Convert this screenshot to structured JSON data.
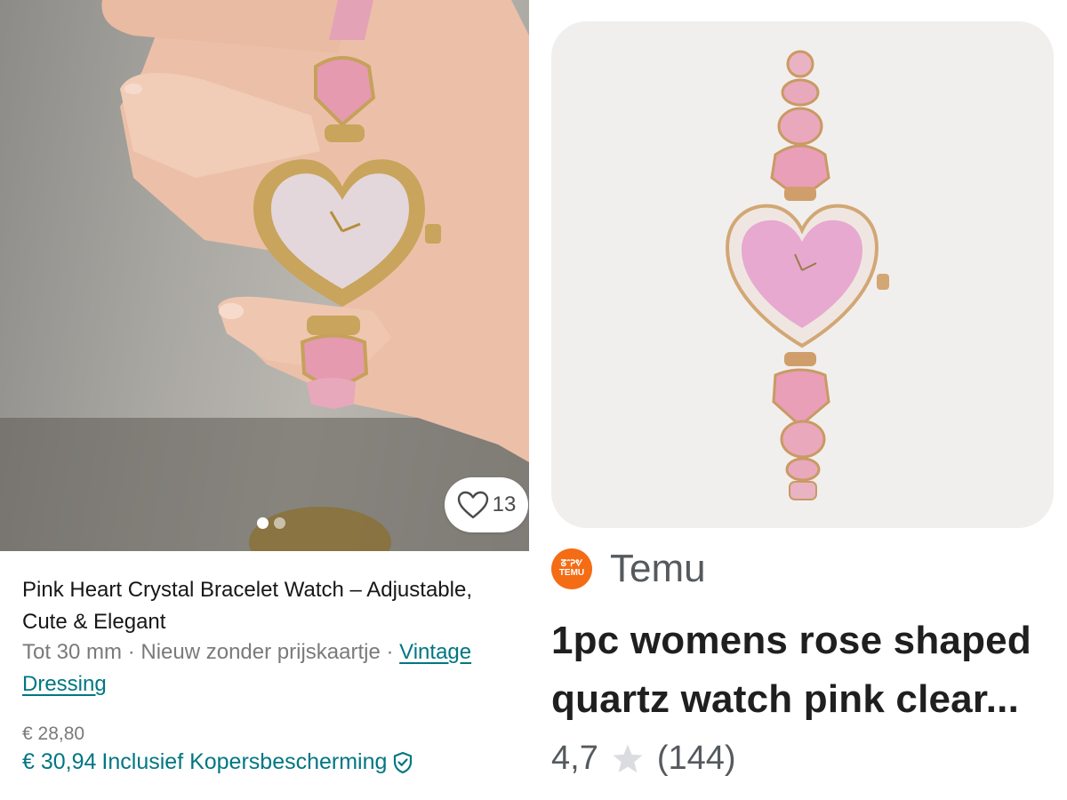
{
  "listing": {
    "favorite_count": "13",
    "carousel": {
      "total": 2,
      "current": 1
    },
    "title": "Pink Heart Crystal Bracelet Watch – Adjustable, Cute & Elegant",
    "size": "Tot 30 mm",
    "separator": " · ",
    "condition": "Nieuw zonder prijskaartje",
    "brand": "Vintage Dressing",
    "price": "€ 28,80",
    "total_price": "€ 30,94",
    "protection_label": "Inclusief Kopersbescherming",
    "colors": {
      "accent": "#007782",
      "muted": "#7a7a7a"
    }
  },
  "product": {
    "seller_logo_text": [
      "ᘔᐢᕈᕓ",
      "TEMU"
    ],
    "seller": "Temu",
    "title": "1pc womens rose shaped quartz watch pink clear...",
    "rating": "4,7",
    "reviews": "(144)",
    "colors": {
      "logo": "#f46c14",
      "star": "#dadce0"
    }
  },
  "icons": [
    "heart-icon",
    "shield-check-icon",
    "star-icon",
    "temu-logo-icon"
  ]
}
